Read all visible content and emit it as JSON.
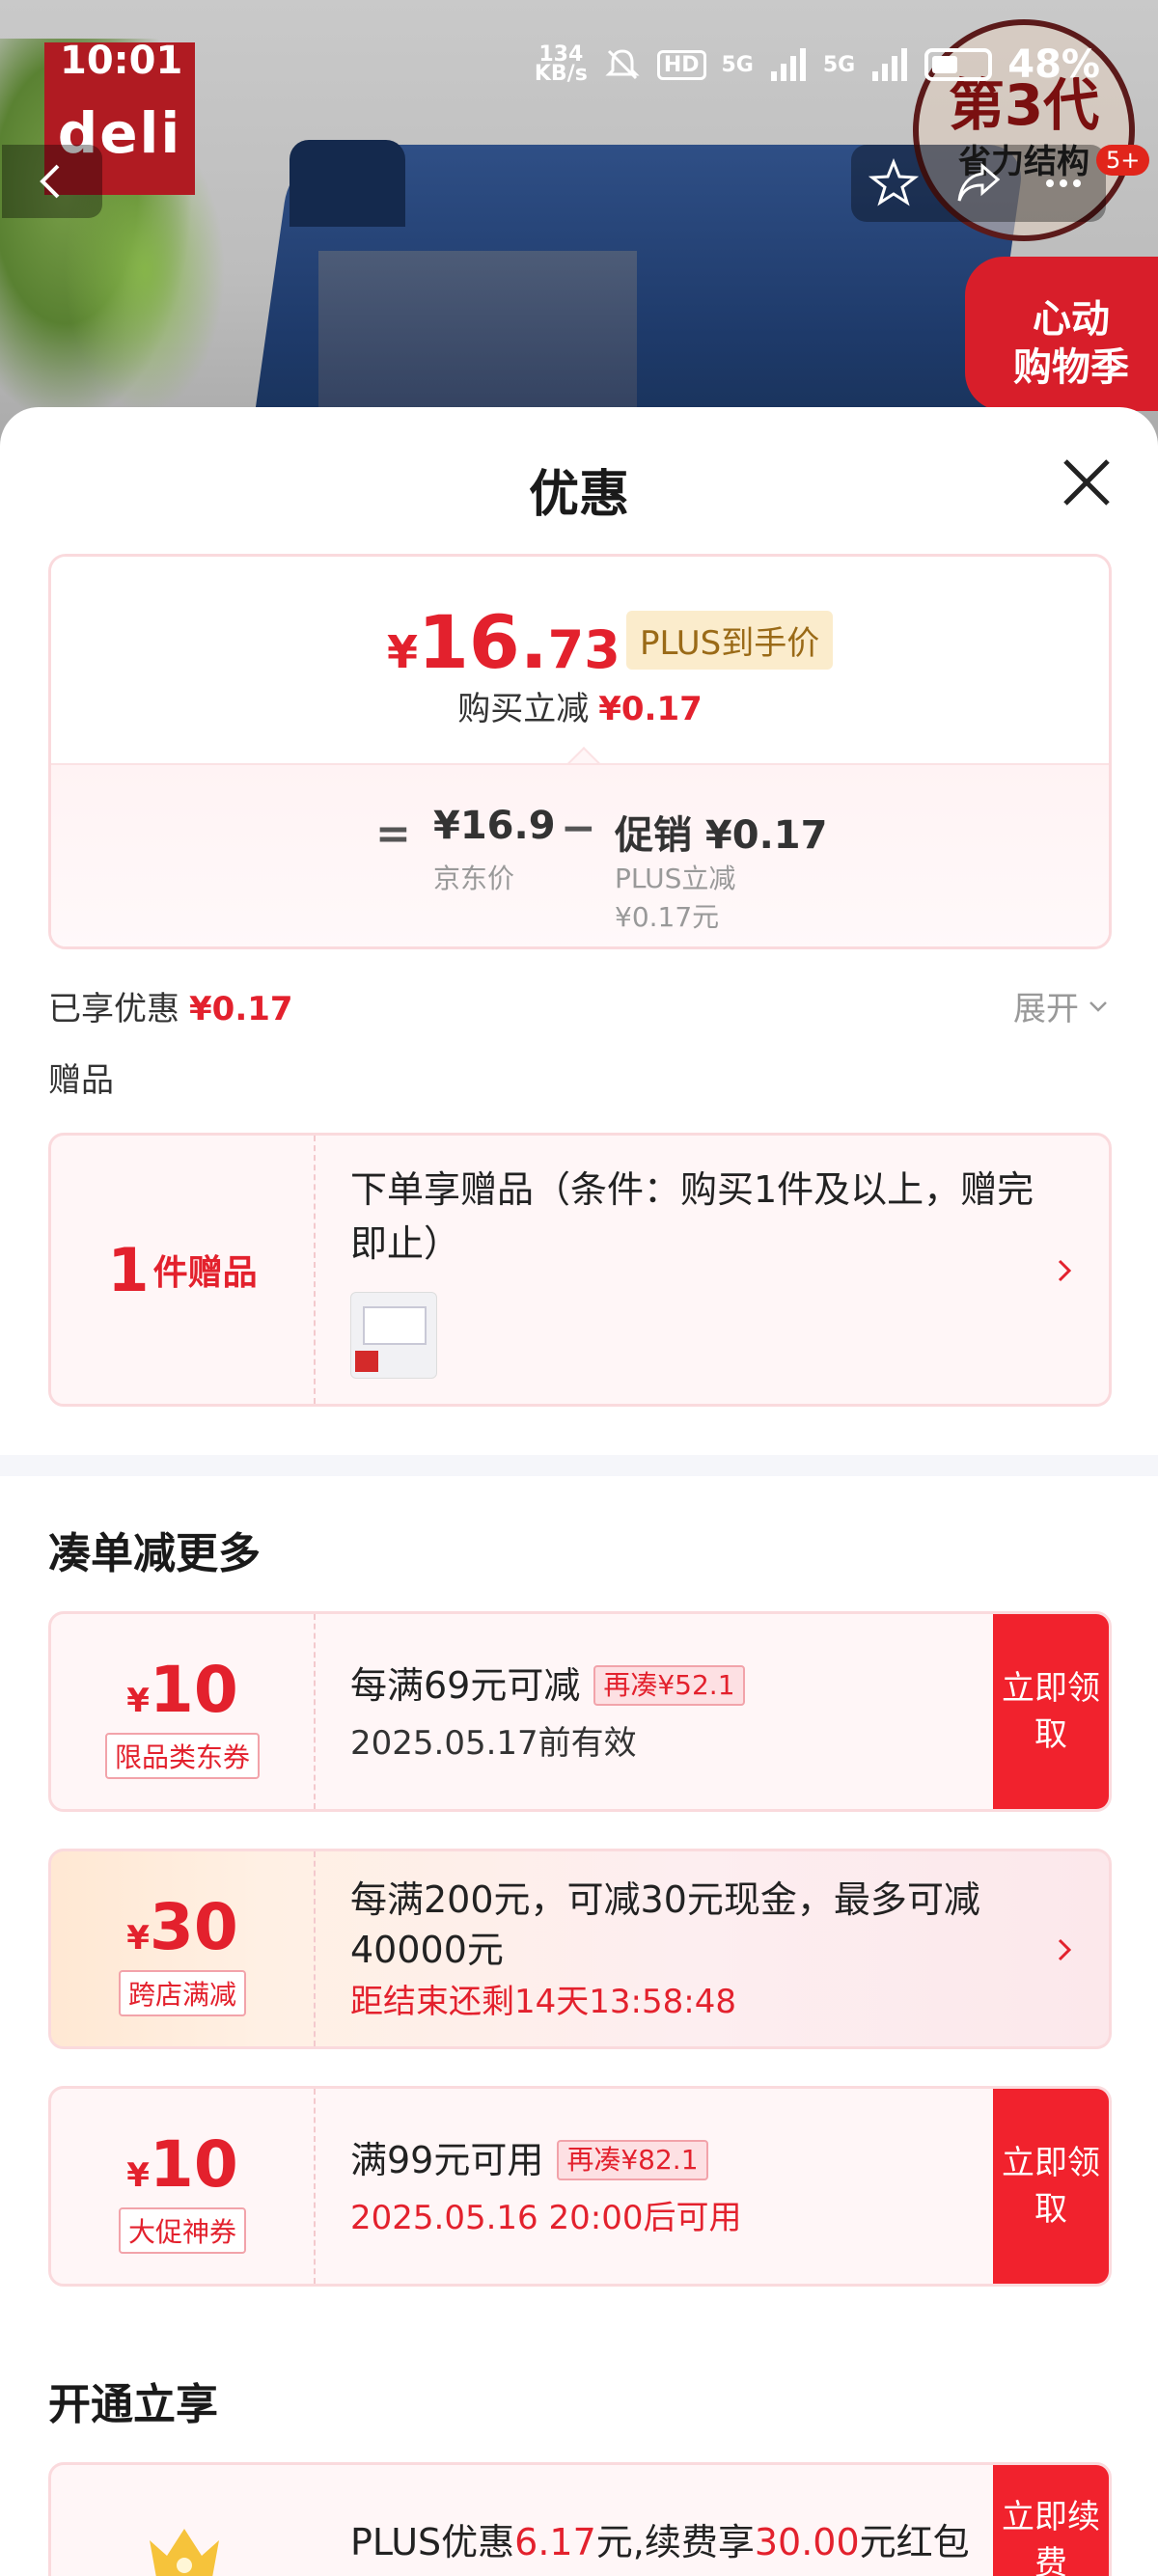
{
  "status_bar": {
    "time": "10:01",
    "net_speed_top": "134",
    "net_speed_bottom": "KB/s",
    "hd": "HD",
    "signal1": "5G",
    "signal2": "5G",
    "battery": "48%"
  },
  "product_image": {
    "brand_logo": "deli",
    "badge_line1": "第3代",
    "badge_line2": "省力结构",
    "corner_promo_line1": "心动",
    "corner_promo_line2": "购物季",
    "cart_badge": "5+"
  },
  "sheet": {
    "title": "优惠"
  },
  "price_summary": {
    "currency": "¥",
    "final_int": "16.",
    "final_dec": "73",
    "plus_tag": "PLUS到手价",
    "instant_label": "购买立减",
    "instant_value": "¥0.17",
    "equals": "=",
    "jd_price": "¥16.9",
    "jd_label": "京东价",
    "minus": "−",
    "promo_price": "促销 ¥0.17",
    "promo_sub1": "PLUS立减",
    "promo_sub2": "¥0.17元"
  },
  "enjoyed": {
    "label": "已享优惠",
    "value": "¥0.17",
    "expand_label": "展开"
  },
  "gift": {
    "section_title": "赠品",
    "count": "1",
    "count_unit": "件赠品",
    "description": "下单享赠品（条件：购买1件及以上，赠完即止）"
  },
  "coupons_section": {
    "title": "凑单减更多",
    "items": [
      {
        "currency": "¥",
        "amount": "10",
        "tag": "限品类东券",
        "line1": "每满69元可减",
        "chip": "再凑¥52.1",
        "line2": "2025.05.17前有效",
        "button": "立即领取"
      },
      {
        "currency": "¥",
        "amount": "30",
        "tag": "跨店满减",
        "line1": "每满200元，可减30元现金，最多可减40000元",
        "line2": "距结束还剩14天13:58:48"
      },
      {
        "currency": "¥",
        "amount": "10",
        "tag": "大促神券",
        "line1": "满99元可用",
        "chip": "再凑¥82.1",
        "line2": "2025.05.16 20:00后可用",
        "button": "立即领取"
      }
    ]
  },
  "plus_section": {
    "title": "开通立享",
    "text_prefix": "PLUS优惠",
    "text_value1": "6.17",
    "text_mid": "元,续费享",
    "text_value2": "30.00",
    "text_suffix": "元红包",
    "button": "立即续费"
  },
  "colors": {
    "accent_red": "#e3212d",
    "button_red": "#f1222d",
    "plus_gold": "#9a6a17"
  }
}
